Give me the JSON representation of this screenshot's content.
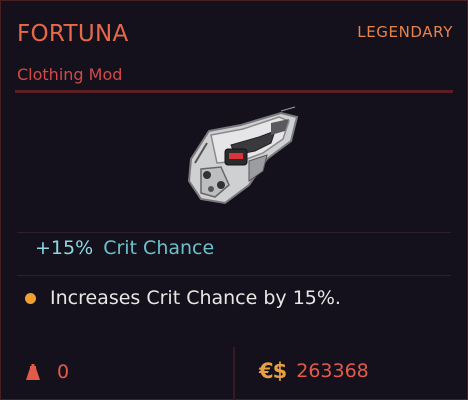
{
  "item": {
    "name": "FORTUNA",
    "rarity": "LEGENDARY",
    "category": "Clothing Mod",
    "image_icon": "gauntlet-mod-icon"
  },
  "stat": {
    "value": "+15%",
    "label": "Crit Chance"
  },
  "effect": {
    "text": "Increases Crit Chance by 15%.",
    "dot_color": "#f0a030"
  },
  "footer": {
    "weight_icon": "weight-icon",
    "weight": "0",
    "currency_icon": "€$",
    "price": "263368"
  },
  "colors": {
    "accent": "#e8694a",
    "stat": "#6cc0c9",
    "price": "#e25a4a"
  }
}
